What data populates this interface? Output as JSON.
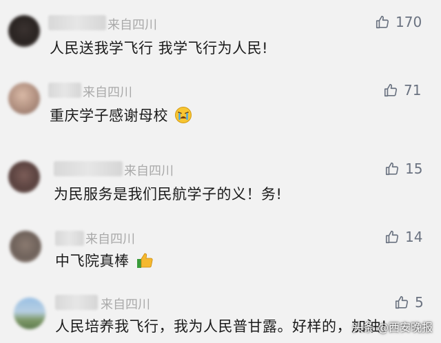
{
  "comments": [
    {
      "location": "来自四川",
      "likes": "170",
      "text": "人民送我学飞行 我学飞行为人民!"
    },
    {
      "location": "来自四川",
      "likes": "71",
      "text": "重庆学子感谢母校"
    },
    {
      "location": "来自四川",
      "likes": "15",
      "text": "为民服务是我们民航学子的义！务!"
    },
    {
      "location": "来自四川",
      "likes": "14",
      "text": "中飞院真棒"
    },
    {
      "location": "来自四川",
      "likes": "5",
      "text": "人民培养我飞行，我为人民普甘露。好样的，加油!"
    }
  ],
  "watermark": "头条 @西安晚报",
  "icons": {
    "like": "thumbs-up-icon",
    "crying": "crying-face-icon",
    "thumbs_emoji": "thumbs-up-emoji"
  },
  "colors": {
    "background": "#f2f2f2",
    "text": "#1b1b1b",
    "location": "#a9a9a9",
    "like": "#6a7280"
  }
}
